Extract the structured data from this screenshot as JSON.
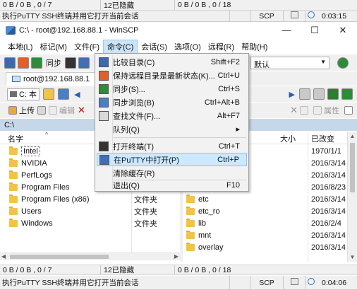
{
  "top_status": {
    "left_transfer": "0 B / 0 B , 0 / 7",
    "selected_hidden": "12已隐藏",
    "right_transfer": "0 B / 0 B , 0 / 18"
  },
  "top_message": {
    "text": "执行PuTTY SSH终端并用它打开当前会话",
    "protocol": "SCP",
    "time": "0:03:15"
  },
  "window": {
    "title": "C:\\ - root@192.168.88.1 - WinSCP",
    "minimize": "—",
    "maximize": "☐",
    "close": "✕"
  },
  "menu": [
    "本地(L)",
    "标记(M)",
    "文件(F)",
    "命令(C)",
    "会话(S)",
    "选项(O)",
    "远程(R)",
    "帮助(H)"
  ],
  "toolbar": {
    "sync_label": "同步",
    "transfer_setting": "默认"
  },
  "session": {
    "tab_label": "root@192.168.88.1"
  },
  "left_panel": {
    "drive": "C: 本",
    "upload_label": "上传",
    "edit_label": "编辑",
    "path": "C:\\",
    "col_name": "名字",
    "rows": [
      {
        "name": "Intel",
        "type": ""
      },
      {
        "name": "NVIDIA",
        "type": ""
      },
      {
        "name": "PerfLogs",
        "type": ""
      },
      {
        "name": "Program Files",
        "type": ""
      },
      {
        "name": "Program Files (x86)",
        "type": "文件夹"
      },
      {
        "name": "Users",
        "type": "文件夹"
      },
      {
        "name": "Windows",
        "type": "文件夹"
      }
    ]
  },
  "right_panel": {
    "properties_label": "属性",
    "col_size": "大小",
    "col_modified": "已改变",
    "rows": [
      {
        "name": "",
        "date": "1970/1/1"
      },
      {
        "name": "",
        "date": "2016/3/14"
      },
      {
        "name": "",
        "date": "2016/3/14"
      },
      {
        "name": "",
        "date": "2016/8/23"
      },
      {
        "name": "etc",
        "date": "2016/3/14"
      },
      {
        "name": "etc_ro",
        "date": "2016/3/14"
      },
      {
        "name": "lib",
        "date": "2016/2/4"
      },
      {
        "name": "mnt",
        "date": "2016/3/14"
      },
      {
        "name": "overlay",
        "date": "2016/3/14"
      }
    ]
  },
  "command_menu": {
    "items": [
      {
        "label": "比较目录(C)",
        "shortcut": "Shift+F2"
      },
      {
        "label": "保持远程目录是最新状态(K)...",
        "shortcut": "Ctrl+U"
      },
      {
        "label": "同步(S)...",
        "shortcut": "Ctrl+S"
      },
      {
        "label": "同步浏览(B)",
        "shortcut": "Ctrl+Alt+B"
      },
      {
        "label": "查找文件(F)...",
        "shortcut": "Alt+F7"
      },
      {
        "label": "队列(Q)",
        "shortcut": "▸"
      },
      {
        "label": "打开终端(T)",
        "shortcut": "Ctrl+T"
      },
      {
        "label": "在PuTTY中打开(P)",
        "shortcut": "Ctrl+P"
      },
      {
        "label": "清除缓存(R)",
        "shortcut": ""
      },
      {
        "label": "退出(Q)",
        "shortcut": "F10"
      }
    ]
  },
  "bottom_status": {
    "left_transfer": "0 B / 0 B , 0 / 7",
    "selected_hidden": "12已隐藏",
    "right_transfer": "0 B / 0 B , 0 / 18"
  },
  "bottom_message": {
    "text": "执行PuTTY SSH终端并用它打开当前会话",
    "protocol": "SCP",
    "time": "0:04:06"
  },
  "colors": {
    "path_bar": "#c7d7ea",
    "menu_highlight": "#cde8ff",
    "folder": "#f1c34a",
    "lock": "#f2b400"
  }
}
